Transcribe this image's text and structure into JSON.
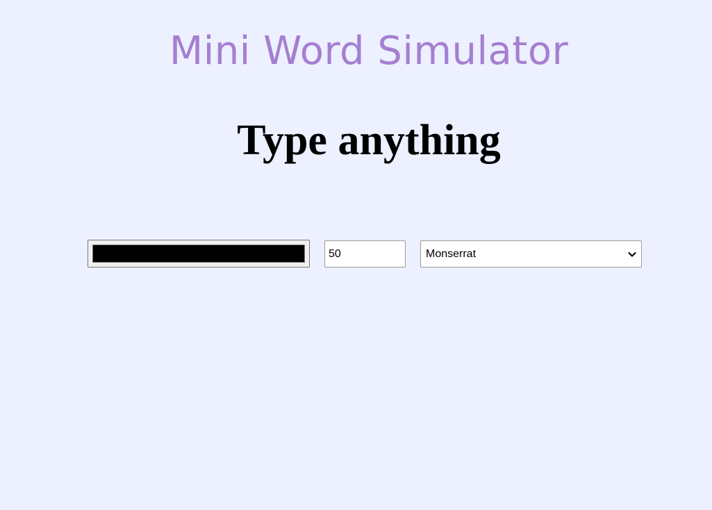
{
  "header": {
    "title": "Mini Word Simulator",
    "title_color": "#a57fd0"
  },
  "preview": {
    "text": "Type anything",
    "text_color": "#000000"
  },
  "controls": {
    "color_value": "#000000",
    "font_size": "50",
    "font_family": "Monserrat",
    "select_icon": "chevron-down-icon"
  },
  "page": {
    "background": "#ecf0ff"
  }
}
